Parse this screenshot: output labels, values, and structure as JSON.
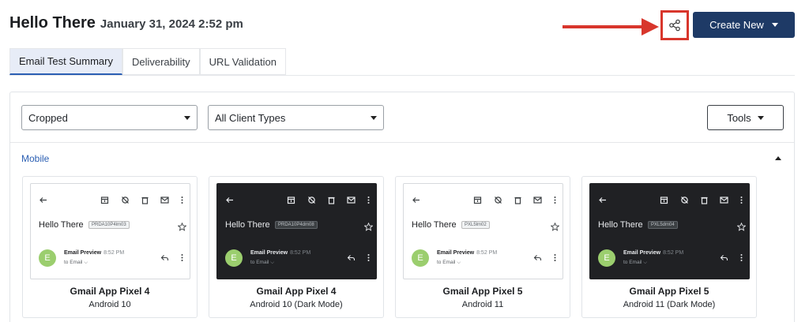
{
  "header": {
    "title": "Hello There",
    "datetime": "January 31, 2024 2:52 pm",
    "share_icon": "share-icon",
    "create_label": "Create New",
    "accent_color": "#1e3a66",
    "highlight_color": "#d8362c"
  },
  "tabs": [
    {
      "label": "Email Test Summary",
      "active": true
    },
    {
      "label": "Deliverability",
      "active": false
    },
    {
      "label": "URL Validation",
      "active": false
    }
  ],
  "filters": {
    "view": "Cropped",
    "client_types": "All Client Types",
    "tools_label": "Tools"
  },
  "section": {
    "label": "Mobile"
  },
  "cards": [
    {
      "theme": "light",
      "title": "Gmail App Pixel 4",
      "subtitle": "Android 10",
      "preview": {
        "subject": "Hello There",
        "chip": "PRDA10P4lm03",
        "avatar": "E",
        "sender": "Email Preview",
        "time": "8:52 PM",
        "to": "to Email"
      }
    },
    {
      "theme": "dark",
      "title": "Gmail App Pixel 4",
      "subtitle": "Android 10 (Dark Mode)",
      "preview": {
        "subject": "Hello There",
        "chip": "PRDA10P4dm08",
        "avatar": "E",
        "sender": "Email Preview",
        "time": "8:52 PM",
        "to": "to Email"
      }
    },
    {
      "theme": "light",
      "title": "Gmail App Pixel 5",
      "subtitle": "Android 11",
      "preview": {
        "subject": "Hello There",
        "chip": "PXL5lm02",
        "avatar": "E",
        "sender": "Email Preview",
        "time": "8:52 PM",
        "to": "to Email"
      }
    },
    {
      "theme": "dark",
      "title": "Gmail App Pixel 5",
      "subtitle": "Android 11 (Dark Mode)",
      "preview": {
        "subject": "Hello There",
        "chip": "PXL5dm04",
        "avatar": "E",
        "sender": "Email Preview",
        "time": "8:52 PM",
        "to": "to Email"
      }
    }
  ]
}
